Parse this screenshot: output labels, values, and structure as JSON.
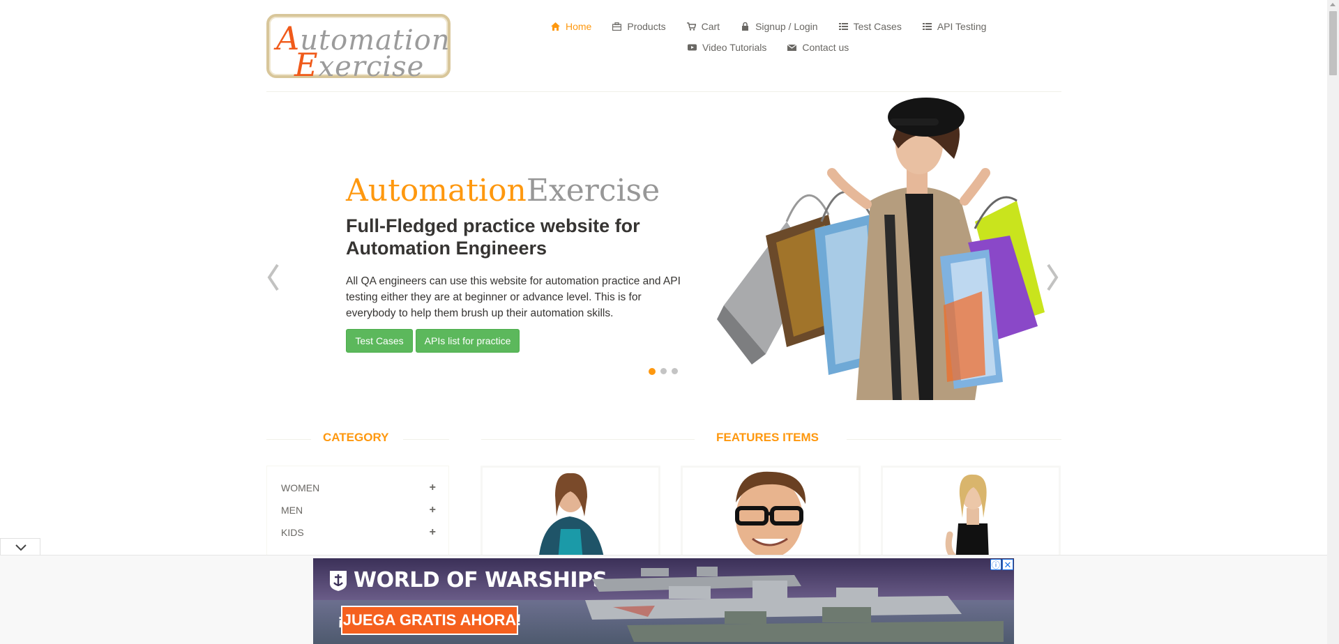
{
  "header": {
    "logo": {
      "line1_cap": "A",
      "line1_rest": "utomation",
      "line2_cap": "E",
      "line2_rest": "xercise"
    },
    "nav": [
      {
        "label": "Home",
        "icon": "home-icon",
        "active": true
      },
      {
        "label": "Products",
        "icon": "briefcase-icon"
      },
      {
        "label": "Cart",
        "icon": "cart-icon"
      },
      {
        "label": "Signup / Login",
        "icon": "lock-icon"
      },
      {
        "label": "Test Cases",
        "icon": "list-icon"
      },
      {
        "label": "API Testing",
        "icon": "list-icon"
      },
      {
        "label": "Video Tutorials",
        "icon": "youtube-icon"
      },
      {
        "label": "Contact us",
        "icon": "envelope-icon"
      }
    ]
  },
  "hero": {
    "title_orange": "Automation",
    "title_grey": "Exercise",
    "subtitle": "Full-Fledged practice website for Automation Engineers",
    "text": "All QA engineers can use this website for automation practice and API testing either they are at beginner or advance level. This is for everybody to help them brush up their automation skills.",
    "buttons": {
      "test_cases": "Test Cases",
      "apis": "APIs list for practice"
    },
    "active_slide": 1,
    "slide_count": 3
  },
  "sidebar": {
    "heading": "Category",
    "categories": [
      {
        "label": "WOMEN"
      },
      {
        "label": "MEN"
      },
      {
        "label": "KIDS"
      }
    ]
  },
  "features": {
    "heading": "Features Items"
  },
  "ad": {
    "title": "WORLD OF WARSHIPS",
    "cta": "¡JUEGA GRATIS AHORA!",
    "info": "ⓘ",
    "close": "✕"
  },
  "colors": {
    "accent": "#fe980f",
    "button_green": "#5cb85c",
    "text": "#696763",
    "heading_dark": "#363432",
    "ad_cta": "#f5601e"
  }
}
